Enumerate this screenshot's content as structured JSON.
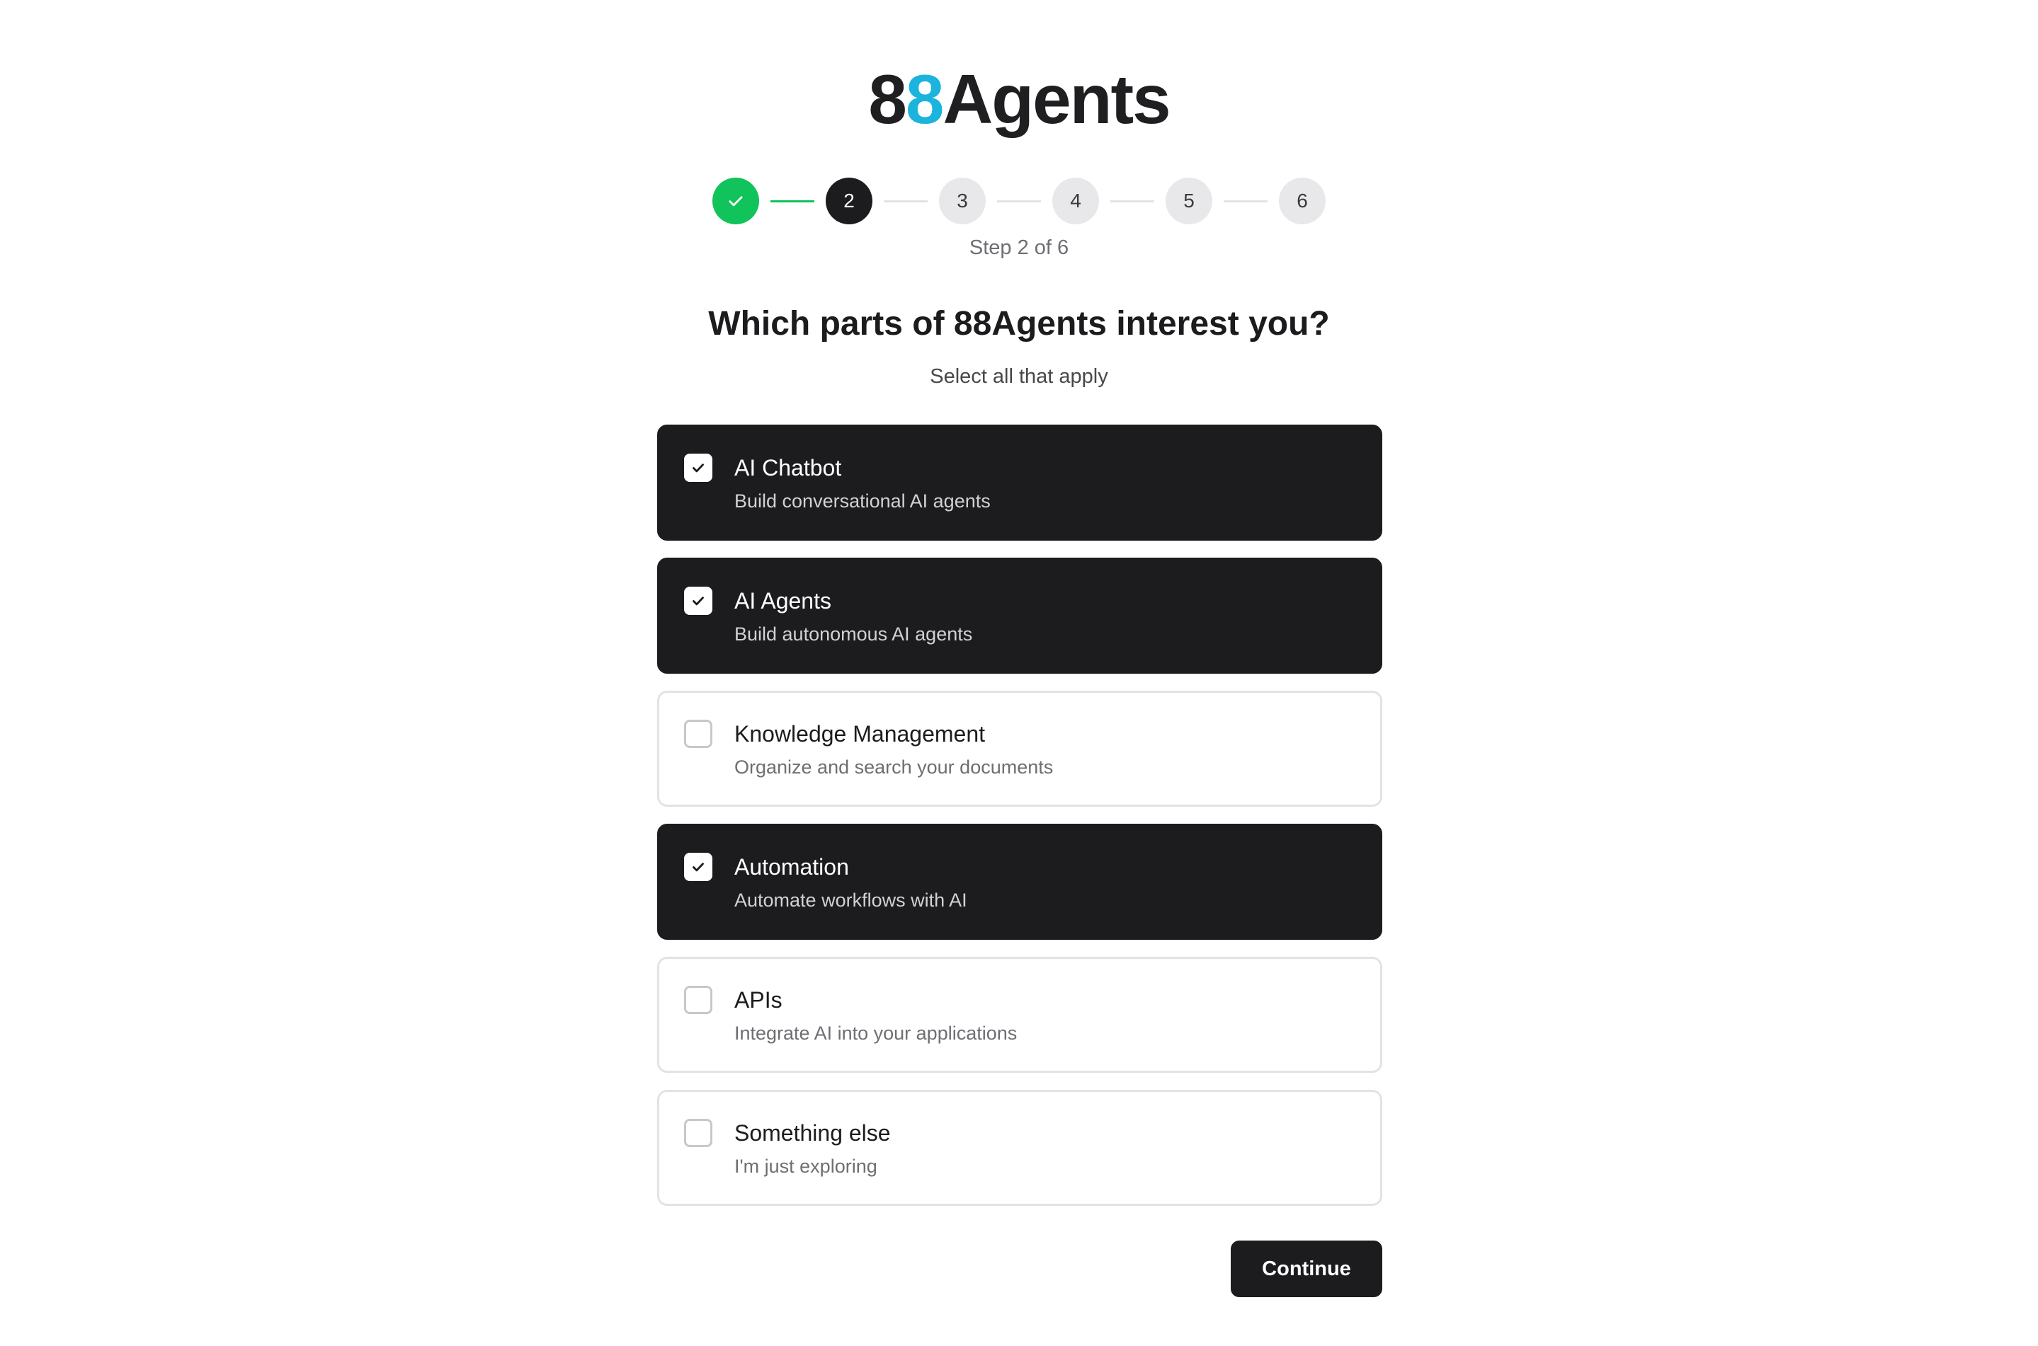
{
  "logo": {
    "prefix": "8",
    "accent": "8",
    "suffix": "Agents"
  },
  "stepper": {
    "steps": [
      {
        "label": "",
        "state": "done"
      },
      {
        "label": "2",
        "state": "current"
      },
      {
        "label": "3",
        "state": "pending"
      },
      {
        "label": "4",
        "state": "pending"
      },
      {
        "label": "5",
        "state": "pending"
      },
      {
        "label": "6",
        "state": "pending"
      }
    ],
    "caption": "Step 2 of 6"
  },
  "question": "Which parts of 88Agents interest you?",
  "subtitle": "Select all that apply",
  "options": [
    {
      "title": "AI Chatbot",
      "description": "Build conversational AI agents",
      "selected": true
    },
    {
      "title": "AI Agents",
      "description": "Build autonomous AI agents",
      "selected": true
    },
    {
      "title": "Knowledge Management",
      "description": "Organize and search your documents",
      "selected": false
    },
    {
      "title": "Automation",
      "description": "Automate workflows with AI",
      "selected": true
    },
    {
      "title": "APIs",
      "description": "Integrate AI into your applications",
      "selected": false
    },
    {
      "title": "Something else",
      "description": "I'm just exploring",
      "selected": false
    }
  ],
  "continue_label": "Continue",
  "colors": {
    "brand_accent": "#1ab4dc",
    "done_green": "#10c35a",
    "selected_bg": "#1c1c1e"
  }
}
